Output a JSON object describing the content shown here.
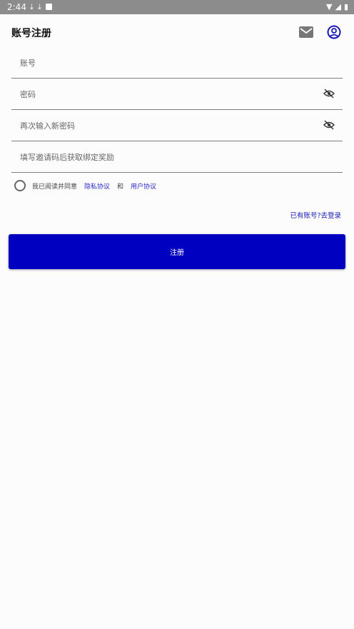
{
  "status_bar": {
    "time": "2:44"
  },
  "header": {
    "title": "账号注册"
  },
  "form": {
    "account_placeholder": "账号",
    "password_placeholder": "密码",
    "confirm_placeholder": "再次输入新密码",
    "invite_placeholder": "填写邀请码后获取绑定奖励"
  },
  "agreement": {
    "prefix": "我已阅读并同意",
    "privacy_link": "隐私协议",
    "and": "和",
    "user_link": "用户协议"
  },
  "login_link": "已有账号?去登录",
  "register_label": "注册",
  "colors": {
    "primary": "#0000c0",
    "link": "#1a1ab8"
  },
  "icons": [
    "download-icon",
    "download-icon",
    "app-icon",
    "wifi-icon",
    "signal-icon",
    "battery-icon",
    "mail-icon",
    "account-circle-icon",
    "eye-off-icon"
  ]
}
